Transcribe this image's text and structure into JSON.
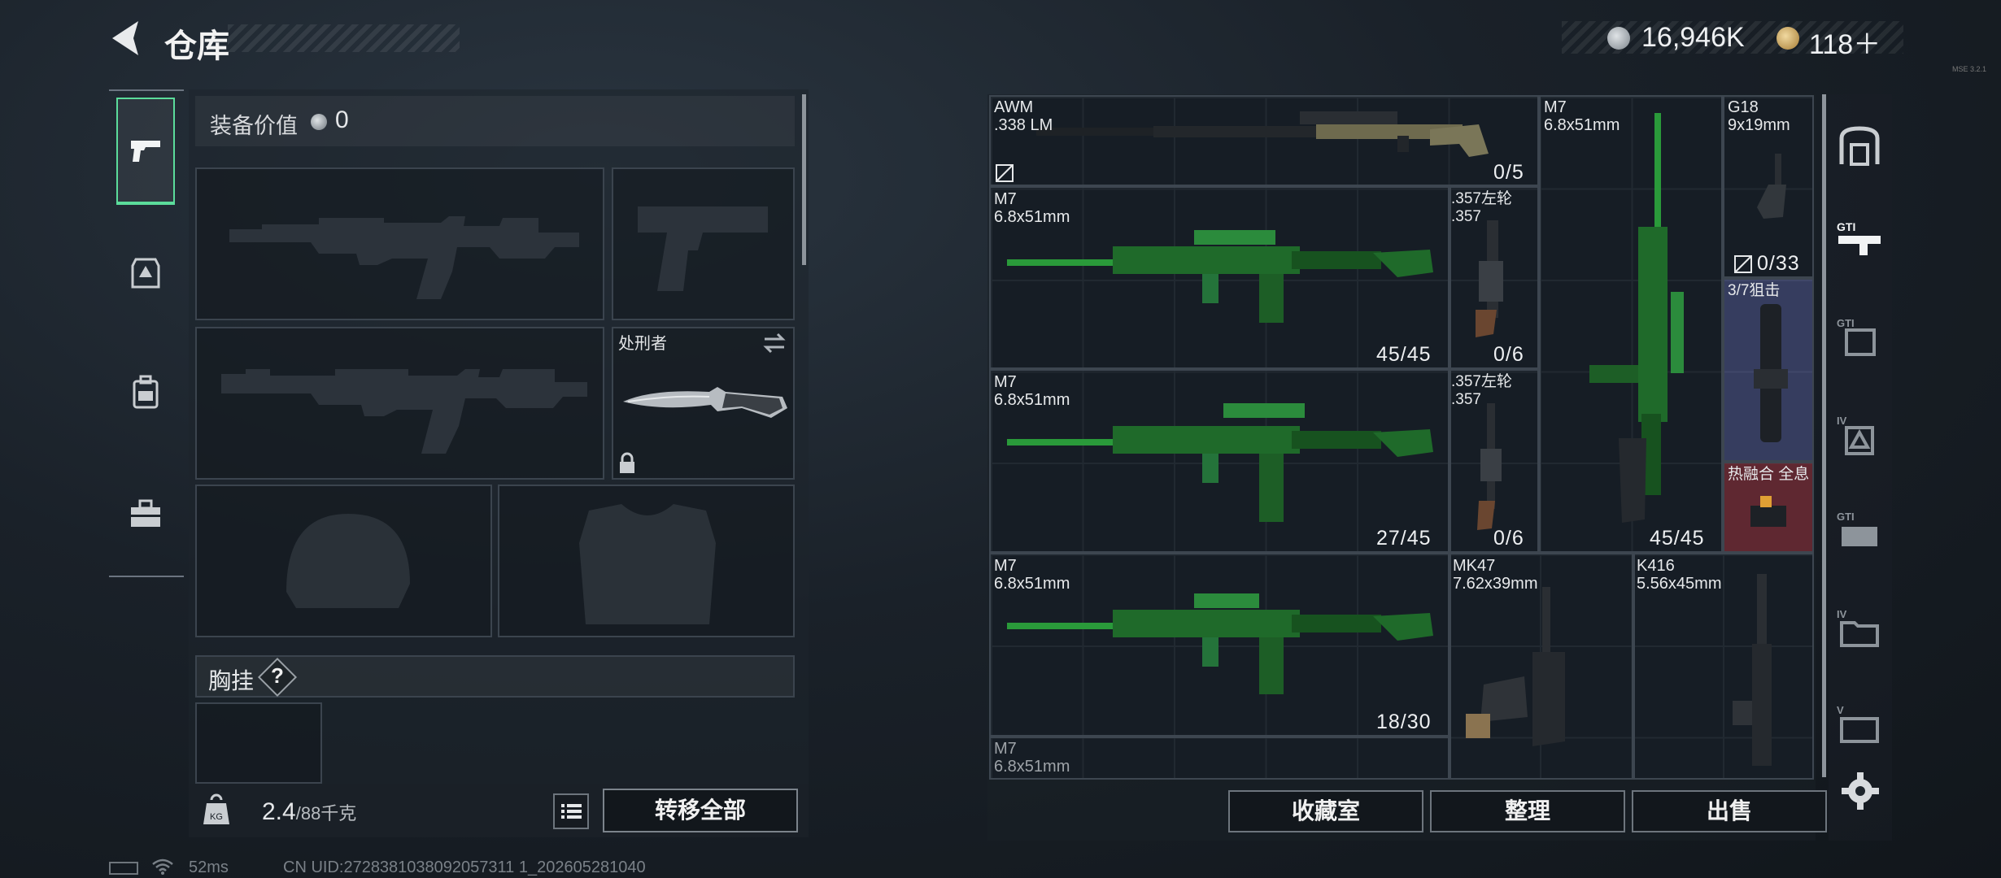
{
  "header": {
    "title": "仓库"
  },
  "currency": {
    "primary": {
      "icon": "silver-coin-icon",
      "value": "16,946K"
    },
    "secondary": {
      "icon": "gold-coin-icon",
      "value": "118＋"
    },
    "tiny_note": "MSE 3.2.1"
  },
  "sidebar": {
    "items": [
      {
        "icon": "pistol-icon",
        "selected": true
      },
      {
        "icon": "armor-icon",
        "selected": false
      },
      {
        "icon": "backpack-icon",
        "selected": false
      },
      {
        "icon": "toolbox-icon",
        "selected": false
      }
    ]
  },
  "loadout": {
    "value_label": "装备价值",
    "value_amount": "0",
    "melee_name": "处刑者",
    "chest_label": "胸挂",
    "help_label": "?",
    "weight_current": "2.4",
    "weight_max": "/88千克",
    "transfer_label": "转移全部"
  },
  "warehouse": {
    "items": [
      {
        "name": "AWM",
        "caliber": ".338 LM",
        "count": "0/5"
      },
      {
        "name": "M7",
        "caliber": "6.8x51mm",
        "count": "45/45"
      },
      {
        "name": ".357左轮",
        "caliber": ".357",
        "count": "0/6"
      },
      {
        "name": "M7",
        "caliber": "6.8x51mm",
        "count": "27/45"
      },
      {
        "name": ".357左轮",
        "caliber": ".357",
        "count": "0/6"
      },
      {
        "name": "M7",
        "caliber": "6.8x51mm",
        "count": "45/45"
      },
      {
        "name": "G18",
        "caliber": "9x19mm",
        "count": "0/33"
      },
      {
        "name": "3/7狙击",
        "caliber": "",
        "count": ""
      },
      {
        "name": "热融合 全息",
        "caliber": "",
        "count": ""
      },
      {
        "name": "M7",
        "caliber": "6.8x51mm",
        "count": "18/30"
      },
      {
        "name": "MK47",
        "caliber": "7.62x39mm",
        "count": ""
      },
      {
        "name": "K416",
        "caliber": "5.56x45mm",
        "count": ""
      },
      {
        "name": "M7",
        "caliber": "6.8x51mm",
        "count": ""
      }
    ],
    "buttons": {
      "collection": "收藏室",
      "sort": "整理",
      "sell": "出售"
    }
  },
  "rail": {
    "items": [
      "safe-icon",
      "gti-rifle-icon",
      "gti-armor-icon",
      "iv-armor-icon",
      "gti-case-icon",
      "iv-folder-icon",
      "v-card-icon"
    ]
  },
  "status": {
    "ping": "52ms",
    "uid": "CN UID:2728381038092057311 1_202605281040"
  },
  "colors": {
    "accent_green": "#5bdc9b",
    "scope_cell": "#50568c",
    "holo_cell": "#7e2c34"
  }
}
